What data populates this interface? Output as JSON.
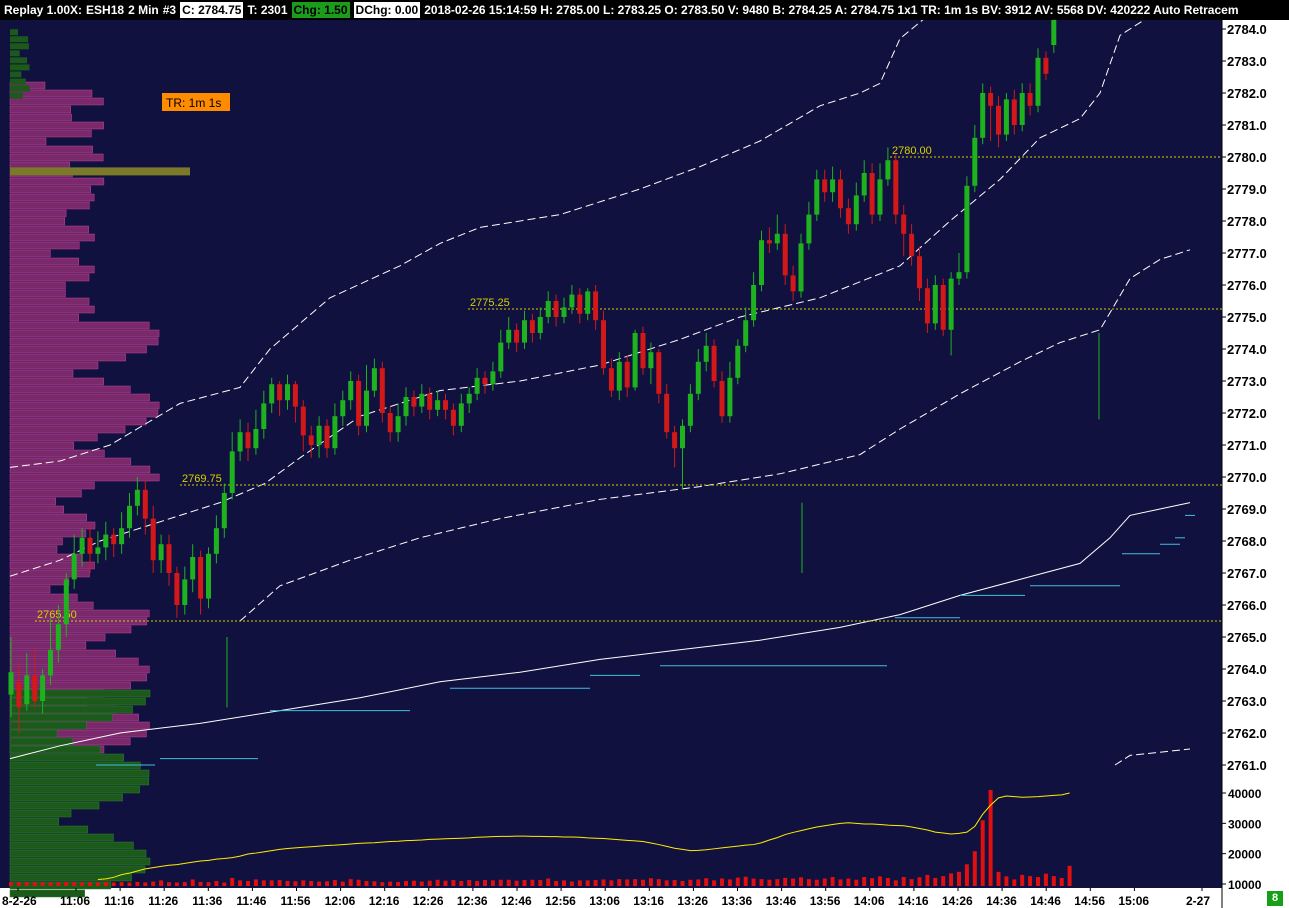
{
  "header": {
    "mode": "Replay 1.00X:",
    "symbol": "ESH18",
    "interval": "2 Min",
    "chart_number": "#3",
    "close": "C: 2784.75",
    "trades": "T: 2301",
    "chg": "Chg: 1.50",
    "dchg": "DChg: 0.00",
    "info": "2018-02-26 15:14:59 H: 2785.00 L: 2783.25 O: 2783.50 V: 9480 B: 2784.25 A: 2784.75 1x1 TR: 1m 1s BV: 3912 AV: 5568 DV: 420222 Auto Retracem"
  },
  "tr_badge": "TR: 1m 1s",
  "bottom_badge": "8",
  "colors": {
    "background": "#11113f",
    "up_candle": "#1fb21f",
    "down_candle": "#d21818",
    "volume_bar": "#e01010",
    "volume_avg": "#ffee00",
    "level_line": "#d6d000",
    "vwap": "#ffffff",
    "profile": "#7a2a6a",
    "profile_low": "#1c5a1c",
    "poc": "#7a7a2a",
    "cyan": "#40c0e0"
  },
  "price_axis": {
    "labels": [
      "2784.0",
      "2783.0",
      "2782.0",
      "2781.0",
      "2780.0",
      "2779.0",
      "2778.0",
      "2777.0",
      "2776.0",
      "2775.0",
      "2774.0",
      "2773.0",
      "2772.0",
      "2771.0",
      "2770.0",
      "2769.0",
      "2768.0",
      "2767.0",
      "2766.0",
      "2765.0",
      "2764.0",
      "2763.0",
      "2762.0",
      "2761.0"
    ],
    "last_price": "2784.75"
  },
  "volume_axis": {
    "labels": [
      "40000",
      "30000",
      "20000",
      "10000"
    ]
  },
  "time_axis": {
    "labels": [
      "8-2-26",
      "11:06",
      "11:16",
      "11:26",
      "11:36",
      "11:46",
      "11:56",
      "12:06",
      "12:16",
      "12:26",
      "12:36",
      "12:46",
      "12:56",
      "13:06",
      "13:16",
      "13:26",
      "13:36",
      "13:46",
      "13:56",
      "14:06",
      "14:16",
      "14:26",
      "14:36",
      "14:46",
      "14:56",
      "15:06",
      "2-27"
    ]
  },
  "levels": [
    {
      "label": "2780.00",
      "price": 2780.0
    },
    {
      "label": "2775.25",
      "price": 2775.25
    },
    {
      "label": "2769.75",
      "price": 2769.75
    },
    {
      "label": "2765.50",
      "price": 2765.5
    }
  ],
  "chart_data": {
    "type": "candlestick",
    "y_range": [
      2760.2,
      2784.8
    ],
    "candles": [
      [
        2763.2,
        2763.9,
        2765.0,
        2762.5
      ],
      [
        2763.6,
        2762.8,
        2764.2,
        2762.0
      ],
      [
        2762.9,
        2763.8,
        2764.5,
        2762.7
      ],
      [
        2763.8,
        2763.0,
        2764.6,
        2762.8
      ],
      [
        2763.0,
        2763.8,
        2764.0,
        2762.6
      ],
      [
        2763.8,
        2764.6,
        2765.6,
        2763.5
      ],
      [
        2764.6,
        2765.4,
        2766.0,
        2764.2
      ],
      [
        2765.4,
        2766.8,
        2767.0,
        2765.0
      ],
      [
        2766.8,
        2767.6,
        2768.2,
        2766.5
      ],
      [
        2767.6,
        2768.1,
        2768.4,
        2767.2
      ],
      [
        2768.1,
        2767.6,
        2768.5,
        2767.0
      ],
      [
        2767.6,
        2767.8,
        2768.3,
        2767.3
      ],
      [
        2767.8,
        2768.2,
        2768.6,
        2767.4
      ],
      [
        2768.2,
        2767.9,
        2768.4,
        2767.5
      ],
      [
        2767.9,
        2768.4,
        2768.9,
        2767.6
      ],
      [
        2768.4,
        2769.1,
        2769.5,
        2768.1
      ],
      [
        2769.1,
        2769.6,
        2770.0,
        2768.8
      ],
      [
        2769.6,
        2768.7,
        2769.9,
        2768.2
      ],
      [
        2768.7,
        2767.4,
        2769.1,
        2767.0
      ],
      [
        2767.4,
        2767.9,
        2768.2,
        2767.0
      ],
      [
        2767.9,
        2767.0,
        2768.2,
        2766.6
      ],
      [
        2767.0,
        2766.0,
        2767.2,
        2765.6
      ],
      [
        2766.0,
        2766.8,
        2767.2,
        2765.7
      ],
      [
        2766.8,
        2767.5,
        2767.9,
        2766.4
      ],
      [
        2767.5,
        2766.2,
        2767.7,
        2765.7
      ],
      [
        2766.2,
        2767.6,
        2767.8,
        2765.9
      ],
      [
        2767.6,
        2768.4,
        2768.8,
        2767.3
      ],
      [
        2768.4,
        2769.5,
        2769.8,
        2768.1
      ],
      [
        2769.5,
        2770.8,
        2771.4,
        2769.3
      ],
      [
        2770.8,
        2771.4,
        2771.8,
        2770.5
      ],
      [
        2771.4,
        2770.9,
        2771.7,
        2770.5
      ],
      [
        2770.9,
        2771.5,
        2772.1,
        2770.7
      ],
      [
        2771.5,
        2772.3,
        2772.7,
        2771.2
      ],
      [
        2772.3,
        2772.9,
        2773.1,
        2772.0
      ],
      [
        2772.9,
        2772.4,
        2773.0,
        2771.9
      ],
      [
        2772.4,
        2772.9,
        2773.2,
        2772.1
      ],
      [
        2772.9,
        2772.2,
        2773.0,
        2771.7
      ],
      [
        2772.2,
        2771.3,
        2772.4,
        2770.8
      ],
      [
        2771.3,
        2771.0,
        2771.6,
        2770.6
      ],
      [
        2771.0,
        2771.6,
        2771.9,
        2770.6
      ],
      [
        2771.6,
        2770.9,
        2771.8,
        2770.6
      ],
      [
        2770.9,
        2771.9,
        2772.3,
        2770.7
      ],
      [
        2771.9,
        2772.4,
        2772.7,
        2771.6
      ],
      [
        2772.4,
        2773.0,
        2773.3,
        2772.1
      ],
      [
        2773.0,
        2771.6,
        2773.2,
        2771.3
      ],
      [
        2771.6,
        2772.7,
        2773.5,
        2771.4
      ],
      [
        2772.7,
        2773.4,
        2773.7,
        2772.5
      ],
      [
        2773.4,
        2772.0,
        2773.6,
        2771.7
      ],
      [
        2772.0,
        2771.4,
        2772.2,
        2771.1
      ],
      [
        2771.4,
        2771.9,
        2772.3,
        2771.1
      ],
      [
        2771.9,
        2772.5,
        2772.8,
        2771.6
      ],
      [
        2772.5,
        2772.2,
        2772.7,
        2771.9
      ],
      [
        2772.2,
        2772.6,
        2772.9,
        2772.0
      ],
      [
        2772.6,
        2772.1,
        2772.8,
        2771.8
      ],
      [
        2772.1,
        2772.4,
        2772.7,
        2771.9
      ],
      [
        2772.4,
        2772.1,
        2772.6,
        2771.8
      ],
      [
        2772.1,
        2771.6,
        2772.3,
        2771.3
      ],
      [
        2771.6,
        2772.3,
        2772.6,
        2771.4
      ],
      [
        2772.3,
        2772.6,
        2772.8,
        2772.0
      ],
      [
        2772.6,
        2773.1,
        2773.4,
        2772.4
      ],
      [
        2773.1,
        2772.9,
        2773.3,
        2772.6
      ],
      [
        2772.9,
        2773.3,
        2773.6,
        2772.7
      ],
      [
        2773.3,
        2774.2,
        2774.6,
        2773.1
      ],
      [
        2774.2,
        2774.6,
        2775.0,
        2774.0
      ],
      [
        2774.6,
        2774.2,
        2774.8,
        2773.9
      ],
      [
        2774.2,
        2774.9,
        2775.2,
        2774.0
      ],
      [
        2774.9,
        2774.5,
        2775.1,
        2774.2
      ],
      [
        2774.5,
        2775.0,
        2775.3,
        2774.3
      ],
      [
        2775.0,
        2775.5,
        2775.8,
        2774.8
      ],
      [
        2775.5,
        2775.0,
        2775.7,
        2774.7
      ],
      [
        2775.0,
        2775.3,
        2775.6,
        2774.8
      ],
      [
        2775.3,
        2775.7,
        2776.0,
        2775.1
      ],
      [
        2775.7,
        2775.1,
        2775.9,
        2774.8
      ],
      [
        2775.1,
        2775.8,
        2775.9,
        2774.9
      ],
      [
        2775.8,
        2774.9,
        2776.0,
        2774.6
      ],
      [
        2774.9,
        2773.4,
        2775.2,
        2773.2
      ],
      [
        2773.4,
        2772.7,
        2773.7,
        2772.5
      ],
      [
        2772.7,
        2773.6,
        2773.9,
        2772.4
      ],
      [
        2773.6,
        2772.8,
        2773.8,
        2772.5
      ],
      [
        2772.8,
        2774.5,
        2774.6,
        2772.7
      ],
      [
        2774.5,
        2773.4,
        2774.7,
        2773.2
      ],
      [
        2773.4,
        2773.9,
        2774.2,
        2772.9
      ],
      [
        2773.9,
        2772.6,
        2774.0,
        2772.3
      ],
      [
        2772.6,
        2771.4,
        2772.9,
        2771.2
      ],
      [
        2771.4,
        2770.9,
        2771.6,
        2770.3
      ],
      [
        2770.9,
        2771.6,
        2771.8,
        2769.6
      ],
      [
        2771.6,
        2772.6,
        2772.9,
        2771.4
      ],
      [
        2772.6,
        2773.6,
        2774.0,
        2772.4
      ],
      [
        2773.6,
        2774.1,
        2774.5,
        2773.3
      ],
      [
        2774.1,
        2773.0,
        2774.3,
        2772.8
      ],
      [
        2773.0,
        2771.9,
        2773.3,
        2771.7
      ],
      [
        2771.9,
        2773.1,
        2773.6,
        2771.7
      ],
      [
        2773.1,
        2774.1,
        2774.3,
        2772.9
      ],
      [
        2774.1,
        2774.9,
        2775.3,
        2773.9
      ],
      [
        2774.9,
        2776.0,
        2776.4,
        2774.7
      ],
      [
        2776.0,
        2777.4,
        2777.7,
        2775.8
      ],
      [
        2777.4,
        2777.3,
        2777.8,
        2777.0
      ],
      [
        2777.3,
        2777.6,
        2778.2,
        2777.1
      ],
      [
        2777.6,
        2776.3,
        2777.9,
        2776.0
      ],
      [
        2776.3,
        2775.8,
        2776.6,
        2775.5
      ],
      [
        2775.8,
        2777.3,
        2777.6,
        2775.6
      ],
      [
        2777.3,
        2778.2,
        2778.6,
        2777.1
      ],
      [
        2778.2,
        2779.3,
        2779.6,
        2778.0
      ],
      [
        2779.3,
        2778.9,
        2779.6,
        2778.6
      ],
      [
        2778.9,
        2779.3,
        2779.7,
        2778.6
      ],
      [
        2779.3,
        2778.4,
        2779.6,
        2778.1
      ],
      [
        2778.4,
        2777.9,
        2778.7,
        2777.6
      ],
      [
        2777.9,
        2778.8,
        2779.2,
        2777.7
      ],
      [
        2778.8,
        2779.5,
        2779.9,
        2778.6
      ],
      [
        2779.5,
        2778.2,
        2779.8,
        2777.9
      ],
      [
        2778.2,
        2779.3,
        2779.8,
        2778.0
      ],
      [
        2779.3,
        2779.9,
        2780.3,
        2779.1
      ],
      [
        2779.9,
        2778.2,
        2780.1,
        2777.9
      ],
      [
        2778.2,
        2777.6,
        2778.5,
        2776.9
      ],
      [
        2777.6,
        2776.9,
        2777.9,
        2776.6
      ],
      [
        2776.9,
        2775.9,
        2777.2,
        2775.5
      ],
      [
        2775.9,
        2774.8,
        2776.2,
        2774.5
      ],
      [
        2774.8,
        2776.0,
        2776.3,
        2774.6
      ],
      [
        2776.0,
        2774.6,
        2776.2,
        2774.4
      ],
      [
        2774.6,
        2776.2,
        2776.4,
        2773.8
      ],
      [
        2776.2,
        2776.4,
        2777.0,
        2776.0
      ],
      [
        2776.4,
        2779.1,
        2779.4,
        2776.2
      ],
      [
        2779.1,
        2780.6,
        2781.0,
        2778.9
      ],
      [
        2780.6,
        2782.0,
        2782.3,
        2780.4
      ],
      [
        2782.0,
        2781.6,
        2782.2,
        2780.5
      ],
      [
        2781.6,
        2780.7,
        2781.9,
        2780.3
      ],
      [
        2780.7,
        2781.8,
        2782.0,
        2780.5
      ],
      [
        2781.8,
        2781.0,
        2782.1,
        2780.7
      ],
      [
        2781.0,
        2782.0,
        2782.3,
        2780.8
      ],
      [
        2782.0,
        2781.6,
        2782.3,
        2781.3
      ],
      [
        2781.6,
        2783.1,
        2783.4,
        2781.4
      ],
      [
        2783.1,
        2782.6,
        2783.3,
        2782.4
      ],
      [
        2783.5,
        2784.75,
        2785.0,
        2783.25
      ]
    ],
    "volume_range": [
      8000,
      42000
    ],
    "volumes": [
      10600,
      10600,
      10600,
      10600,
      10500,
      10500,
      10600,
      10700,
      10600,
      10500,
      10600,
      10500,
      10700,
      10500,
      10600,
      10500,
      10700,
      10500,
      10800,
      11200,
      10600,
      10500,
      10600,
      11500,
      10700,
      10600,
      11000,
      10500,
      12000,
      11200,
      11000,
      11500,
      11200,
      11200,
      11300,
      11000,
      10900,
      11200,
      11000,
      10800,
      10900,
      11300,
      10800,
      11600,
      11400,
      11000,
      10900,
      10600,
      10800,
      10700,
      11000,
      11100,
      10800,
      11100,
      11400,
      11100,
      11300,
      11000,
      11300,
      11000,
      11300,
      11200,
      11400,
      11400,
      11100,
      11300,
      11400,
      11300,
      11800,
      11000,
      11200,
      10800,
      11200,
      11200,
      11300,
      11500,
      11200,
      11600,
      11500,
      11600,
      11400,
      11900,
      11600,
      11200,
      11300,
      11000,
      11400,
      11500,
      11900,
      11200,
      11800,
      11500,
      12100,
      12400,
      11800,
      11600,
      11400,
      11600,
      12000,
      11800,
      12200,
      11600,
      11400,
      11800,
      12300,
      11500,
      11800,
      11400,
      12300,
      11900,
      12500,
      12000,
      11200,
      12300,
      11600,
      12200,
      13000,
      12000,
      12600,
      13500,
      14000,
      16500,
      20800,
      31000,
      41000,
      14000,
      12500,
      11500,
      13000,
      12600,
      12300,
      13400,
      12600,
      12000,
      16000
    ],
    "volume_avg": [
      null,
      null,
      null,
      null,
      null,
      null,
      null,
      null,
      null,
      null,
      null,
      11500,
      11700,
      12200,
      13100,
      13600,
      14300,
      15000,
      15400,
      15800,
      16200,
      16400,
      16800,
      17200,
      17600,
      17800,
      18200,
      18400,
      18700,
      19200,
      19900,
      20200,
      20600,
      21000,
      21400,
      21700,
      21900,
      22100,
      22300,
      22500,
      22700,
      22800,
      23000,
      23200,
      23400,
      23500,
      23600,
      23800,
      24000,
      24100,
      24300,
      24400,
      24500,
      24700,
      24800,
      24900,
      25000,
      25100,
      25200,
      25400,
      25500,
      25600,
      25700,
      25700,
      25800,
      25800,
      25700,
      25700,
      25600,
      25600,
      25500,
      25500,
      25400,
      25200,
      25100,
      25000,
      24800,
      24600,
      24400,
      24200,
      24000,
      23500,
      23000,
      22400,
      21800,
      21400,
      21000,
      21100,
      21300,
      21600,
      21900,
      22200,
      22500,
      22800,
      23000,
      23600,
      24500,
      25300,
      26300,
      27000,
      27600,
      28200,
      28800,
      29200,
      29600,
      30000,
      30200,
      30000,
      29800,
      29800,
      29600,
      29400,
      29300,
      29200,
      28800,
      28300,
      27800,
      27100,
      26800,
      26500,
      26700,
      27100,
      29000,
      33000,
      36000,
      38400,
      39000,
      38800,
      38600,
      38700,
      38800,
      39000,
      39200,
      39400,
      40000
    ]
  }
}
